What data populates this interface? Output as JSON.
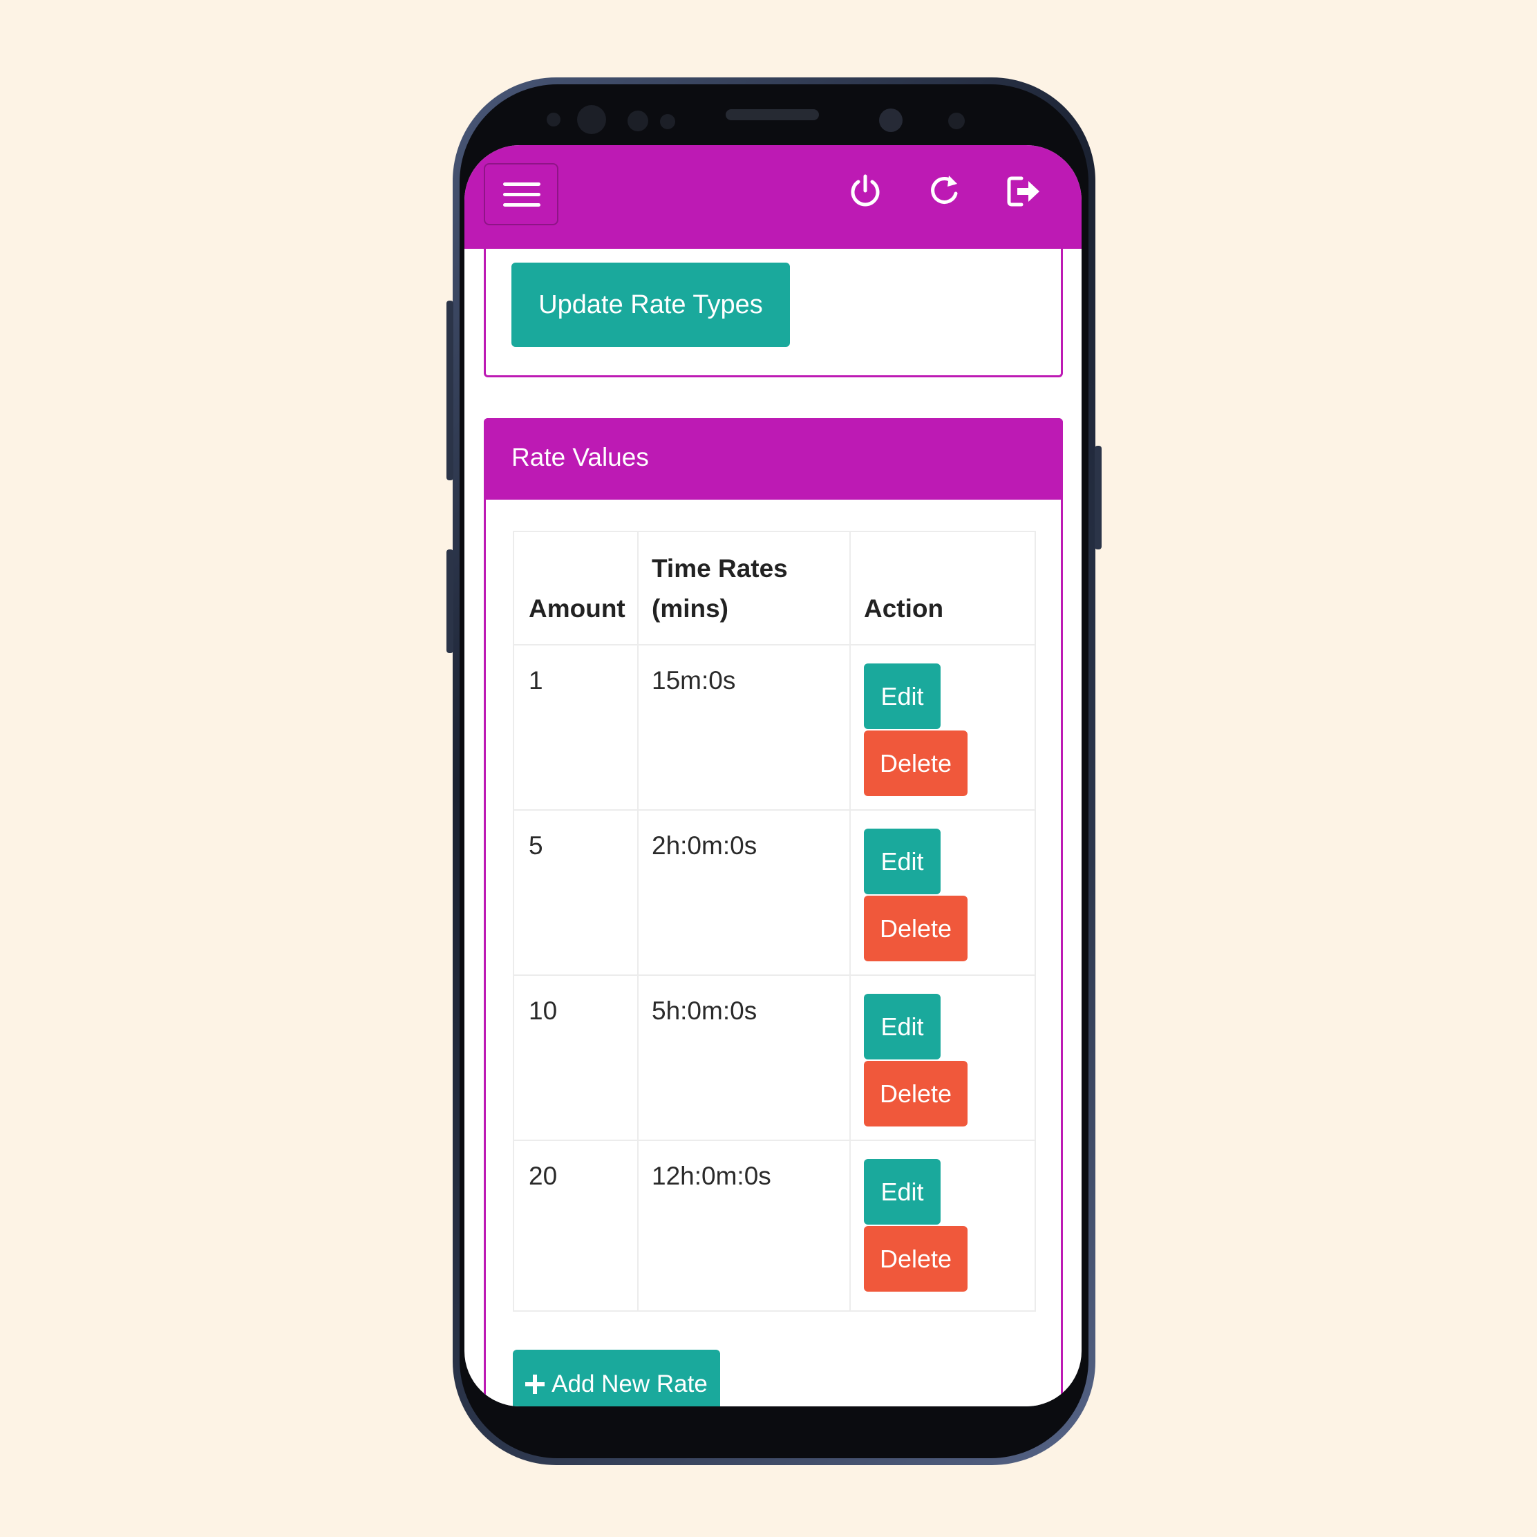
{
  "header": {
    "menu_icon": "hamburger-menu-icon",
    "icons": [
      "power-icon",
      "refresh-icon",
      "logout-icon"
    ]
  },
  "rate_types": {
    "update_button": "Update Rate Types"
  },
  "rate_values": {
    "title": "Rate Values",
    "columns": [
      "Amount",
      "Time Rates",
      "(mins)",
      "Action"
    ],
    "rows": [
      {
        "amount": "1",
        "time": "15m:0s",
        "edit": "Edit",
        "delete": "Delete"
      },
      {
        "amount": "5",
        "time": "2h:0m:0s",
        "edit": "Edit",
        "delete": "Delete"
      },
      {
        "amount": "10",
        "time": "5h:0m:0s",
        "edit": "Edit",
        "delete": "Delete"
      },
      {
        "amount": "20",
        "time": "12h:0m:0s",
        "edit": "Edit",
        "delete": "Delete"
      }
    ],
    "add_button": "Add New Rate"
  },
  "colors": {
    "brand": "#bd1ab4",
    "primary": "#1aa99c",
    "danger": "#f0583b",
    "background": "#fdf3e5"
  }
}
